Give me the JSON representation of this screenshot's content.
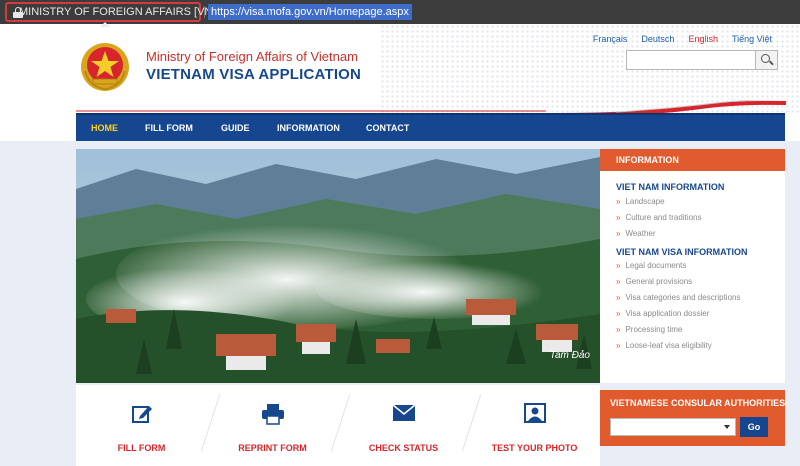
{
  "browser": {
    "security_label": "MINISTRY OF FOREIGN AFFAIRS [VN]",
    "url": "https://visa.mofa.gov.vn/Homepage.aspx"
  },
  "header": {
    "ministry": "Ministry of Foreign Affairs of Vietnam",
    "app_title": "VIETNAM VISA APPLICATION",
    "languages": [
      {
        "label": "Français"
      },
      {
        "label": "Deutsch"
      },
      {
        "label": "English"
      },
      {
        "label": "Tiếng Việt"
      }
    ],
    "active_language": "English",
    "search": {
      "value": "",
      "icon": "search-icon"
    }
  },
  "nav": {
    "items": [
      {
        "label": "HOME"
      },
      {
        "label": "FILL FORM"
      },
      {
        "label": "GUIDE"
      },
      {
        "label": "INFORMATION"
      },
      {
        "label": "CONTACT"
      }
    ],
    "active": "HOME"
  },
  "hero": {
    "caption": "Tam Đảo"
  },
  "info": {
    "title": "INFORMATION",
    "sections": [
      {
        "heading": "VIET NAM INFORMATION",
        "links": [
          "Landscape",
          "Culture and traditions",
          "Weather"
        ]
      },
      {
        "heading": "VIET NAM VISA INFORMATION",
        "links": [
          "Legal documents",
          "General provisions",
          "Visa categories and descriptions",
          "Visa application dossier",
          "Processing time",
          "Loose-leaf visa eligibility"
        ]
      }
    ]
  },
  "actions": [
    {
      "label": "FILL FORM",
      "icon": "edit-form-icon"
    },
    {
      "label": "REPRINT FORM",
      "icon": "printer-icon"
    },
    {
      "label": "CHECK STATUS",
      "icon": "envelope-icon"
    },
    {
      "label": "TEST YOUR PHOTO",
      "icon": "photo-icon"
    }
  ],
  "consular": {
    "title": "VIETNAMESE CONSULAR AUTHORITIES",
    "selected": "",
    "go_label": "Go"
  },
  "colors": {
    "brand_blue": "#15468f",
    "brand_red": "#d6262c",
    "accent_orange": "#e05a2d",
    "nav_active": "#ffd21e"
  }
}
